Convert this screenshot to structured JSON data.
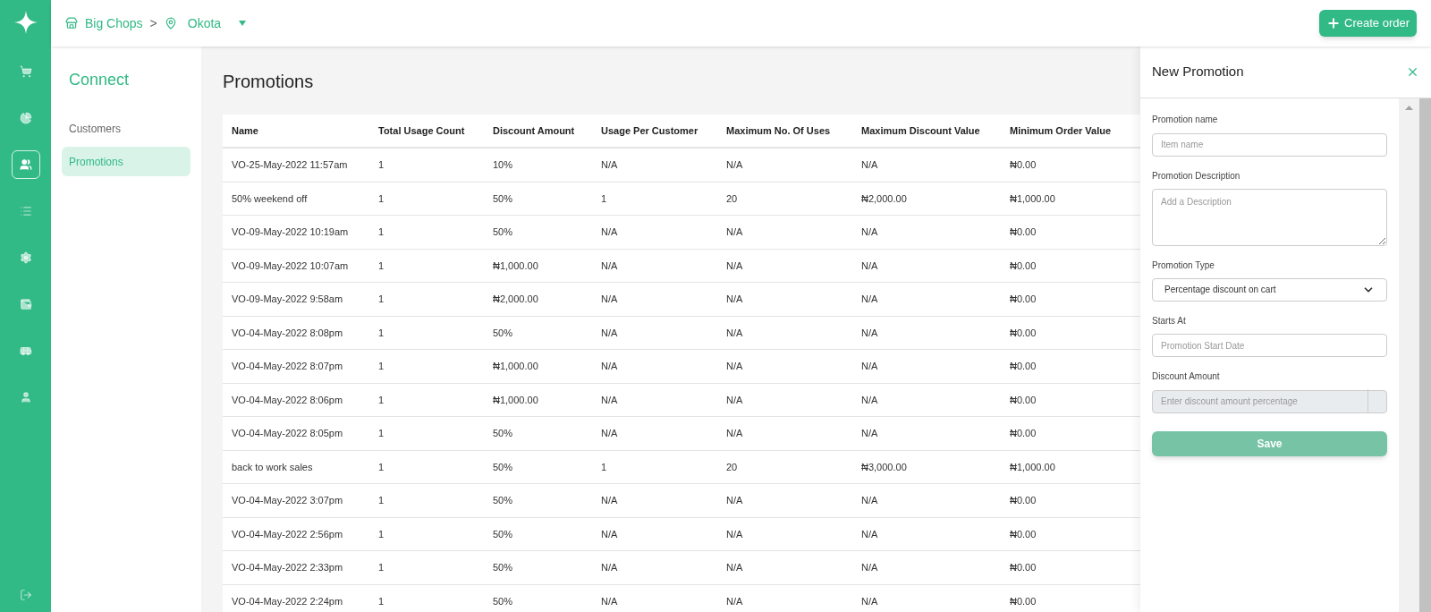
{
  "rail": [
    {
      "selected": false
    },
    {
      "selected": false
    },
    {
      "selected": true
    },
    {
      "selected": false
    },
    {
      "selected": false
    },
    {
      "selected": false
    },
    {
      "selected": false
    },
    {
      "selected": false
    }
  ],
  "topbar": {
    "store": "Big Chops",
    "separator": ">",
    "location": "Okota",
    "create_button": "Create order"
  },
  "sidebar": {
    "title": "Connect",
    "items": [
      {
        "label": "Customers",
        "selected": false
      },
      {
        "label": "Promotions",
        "selected": true
      }
    ]
  },
  "page": {
    "title": "Promotions"
  },
  "table": {
    "columns": [
      "Name",
      "Total Usage Count",
      "Discount Amount",
      "Usage Per Customer",
      "Maximum No. Of Uses",
      "Maximum Discount Value",
      "Minimum Order Value"
    ],
    "rows": [
      [
        "VO-25-May-2022 11:57am",
        "1",
        "10%",
        "N/A",
        "N/A",
        "N/A",
        "₦0.00"
      ],
      [
        "50% weekend off",
        "1",
        "50%",
        "1",
        "20",
        "₦2,000.00",
        "₦1,000.00"
      ],
      [
        "VO-09-May-2022 10:19am",
        "1",
        "50%",
        "N/A",
        "N/A",
        "N/A",
        "₦0.00"
      ],
      [
        "VO-09-May-2022 10:07am",
        "1",
        "₦1,000.00",
        "N/A",
        "N/A",
        "N/A",
        "₦0.00"
      ],
      [
        "VO-09-May-2022 9:58am",
        "1",
        "₦2,000.00",
        "N/A",
        "N/A",
        "N/A",
        "₦0.00"
      ],
      [
        "VO-04-May-2022 8:08pm",
        "1",
        "50%",
        "N/A",
        "N/A",
        "N/A",
        "₦0.00"
      ],
      [
        "VO-04-May-2022 8:07pm",
        "1",
        "₦1,000.00",
        "N/A",
        "N/A",
        "N/A",
        "₦0.00"
      ],
      [
        "VO-04-May-2022 8:06pm",
        "1",
        "₦1,000.00",
        "N/A",
        "N/A",
        "N/A",
        "₦0.00"
      ],
      [
        "VO-04-May-2022 8:05pm",
        "1",
        "50%",
        "N/A",
        "N/A",
        "N/A",
        "₦0.00"
      ],
      [
        "back to work sales",
        "1",
        "50%",
        "1",
        "20",
        "₦3,000.00",
        "₦1,000.00"
      ],
      [
        "VO-04-May-2022 3:07pm",
        "1",
        "50%",
        "N/A",
        "N/A",
        "N/A",
        "₦0.00"
      ],
      [
        "VO-04-May-2022 2:56pm",
        "1",
        "50%",
        "N/A",
        "N/A",
        "N/A",
        "₦0.00"
      ],
      [
        "VO-04-May-2022 2:33pm",
        "1",
        "50%",
        "N/A",
        "N/A",
        "N/A",
        "₦0.00"
      ],
      [
        "VO-04-May-2022 2:24pm",
        "1",
        "50%",
        "N/A",
        "N/A",
        "N/A",
        "₦0.00"
      ]
    ]
  },
  "panel": {
    "title": "New Promotion",
    "fields": [
      {
        "kind": "input",
        "label": "Promotion name",
        "placeholder": "Item name",
        "disabled": false
      },
      {
        "kind": "textarea",
        "label": "Promotion Description",
        "placeholder": "Add a Description",
        "disabled": false
      },
      {
        "kind": "select",
        "label": "Promotion Type",
        "value": "Percentage discount on cart",
        "disabled": false
      },
      {
        "kind": "input",
        "label": "Starts At",
        "placeholder": "Promotion Start Date",
        "disabled": false
      },
      {
        "kind": "input",
        "label": "Discount Amount",
        "placeholder": "Enter discount amount percentage",
        "disabled": true
      }
    ],
    "save_button": "Save"
  }
}
